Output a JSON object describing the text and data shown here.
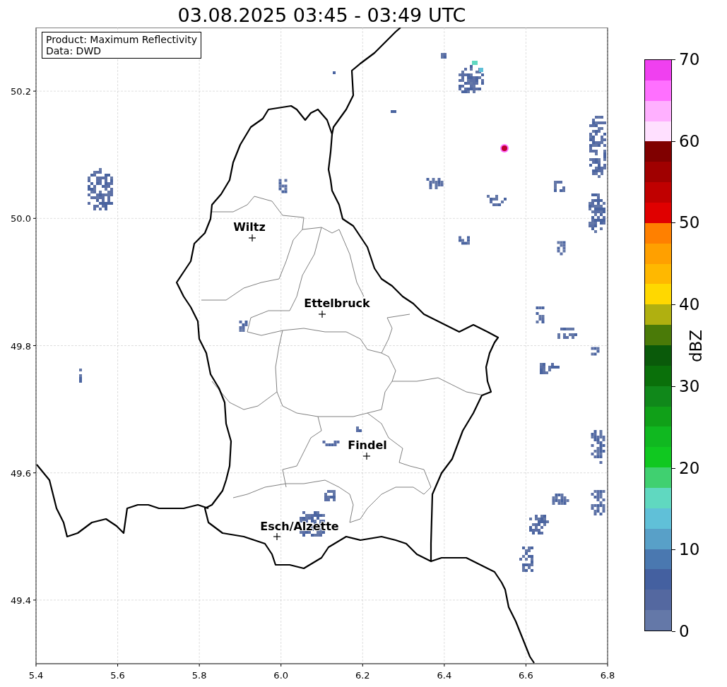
{
  "title": "03.08.2025 03:45 - 03:49 UTC",
  "info_box": [
    "Product: Maximum Reflectivity",
    "Data: DWD"
  ],
  "map": {
    "x_axis_labels": [
      "5.4",
      "5.6",
      "5.8",
      "6.0",
      "6.2",
      "6.4",
      "6.6",
      "6.8"
    ],
    "y_axis_labels": [
      "50.2",
      "50.0",
      "49.8",
      "49.6",
      "49.4"
    ],
    "places": [
      {
        "name": "Wiltz"
      },
      {
        "name": "Ettelbruck"
      },
      {
        "name": "Findel"
      },
      {
        "name": "Esch/Alzette"
      }
    ]
  },
  "colorbar": {
    "label": "dBZ",
    "ticks": [
      "70",
      "60",
      "50",
      "40",
      "30",
      "20",
      "10",
      "0"
    ],
    "bands": [
      {
        "color": "#f040f0"
      },
      {
        "color": "#ff70ff"
      },
      {
        "color": "#ffb0ff"
      },
      {
        "color": "#ffe0ff"
      },
      {
        "color": "#800000"
      },
      {
        "color": "#a00000"
      },
      {
        "color": "#c00000"
      },
      {
        "color": "#e00000"
      },
      {
        "color": "#ff8000"
      },
      {
        "color": "#ffa000"
      },
      {
        "color": "#ffb800"
      },
      {
        "color": "#ffd800"
      },
      {
        "color": "#b0b010"
      },
      {
        "color": "#4a7a08"
      },
      {
        "color": "#0a5a0a"
      },
      {
        "color": "#0a700a"
      },
      {
        "color": "#10881a"
      },
      {
        "color": "#10a018"
      },
      {
        "color": "#10b820"
      },
      {
        "color": "#10c820"
      },
      {
        "color": "#40d070"
      },
      {
        "color": "#60d8c0"
      },
      {
        "color": "#60c0d8"
      },
      {
        "color": "#58a0c8"
      },
      {
        "color": "#4a78b0"
      },
      {
        "color": "#4460a0"
      },
      {
        "color": "#5468a0"
      },
      {
        "color": "#6478a8"
      }
    ]
  }
}
